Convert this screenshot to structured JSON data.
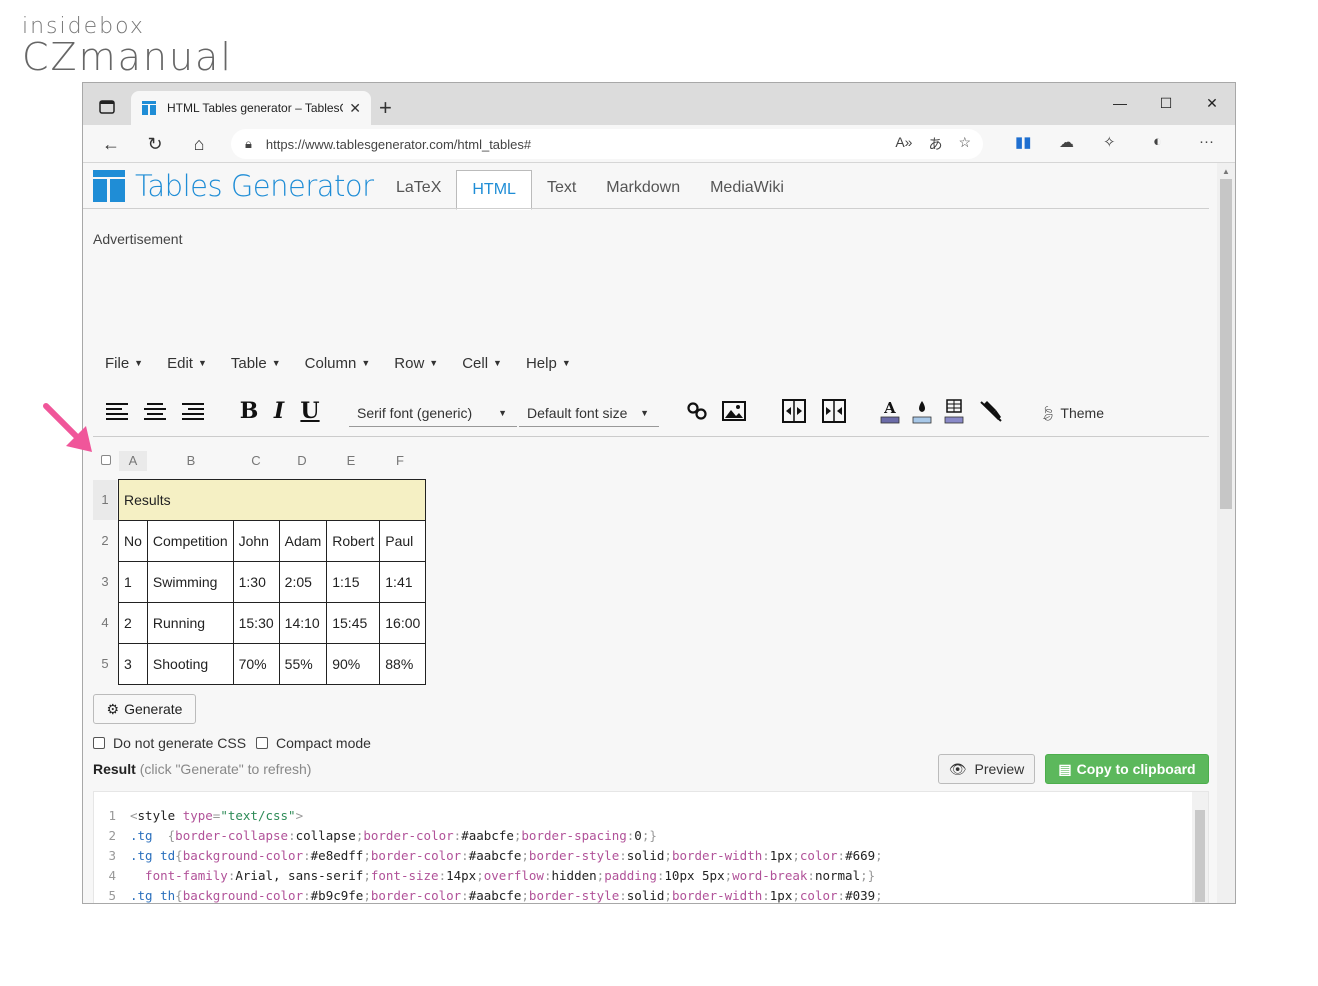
{
  "watermark": {
    "line1": "insidebox",
    "line2": "CZmanual"
  },
  "browser": {
    "tab_title": "HTML Tables generator – TablesG",
    "url": "https://www.tablesgenerator.com/html_tables#",
    "icons": [
      "tab-actions-icon",
      "close-tab-icon",
      "new-tab-icon",
      "back-icon",
      "refresh-icon",
      "home-icon",
      "lock-icon",
      "read-aloud-icon",
      "translate-icon",
      "favorite-add-icon",
      "collections-icon",
      "cloud-icon",
      "extensions-icon",
      "profile-icon",
      "more-icon",
      "minimize-icon",
      "maximize-icon",
      "close-window-icon"
    ]
  },
  "site": {
    "brand": "Tables Generator",
    "tabs": [
      "LaTeX",
      "HTML",
      "Text",
      "Markdown",
      "MediaWiki"
    ],
    "active_tab": "HTML",
    "advertisement": "Advertisement",
    "menus": [
      "File",
      "Edit",
      "Table",
      "Column",
      "Row",
      "Cell",
      "Help"
    ],
    "font_select": "Serif font (generic)",
    "size_select": "Default font size",
    "theme": "Theme",
    "columns": [
      "A",
      "B",
      "C",
      "D",
      "E",
      "F"
    ],
    "row_numbers": [
      "1",
      "2",
      "3",
      "4",
      "5"
    ],
    "table": {
      "title": "Results",
      "header": [
        "No",
        "Competition",
        "John",
        "Adam",
        "Robert",
        "Paul"
      ],
      "rows": [
        [
          "1",
          "Swimming",
          "1:30",
          "2:05",
          "1:15",
          "1:41"
        ],
        [
          "2",
          "Running",
          "15:30",
          "14:10",
          "15:45",
          "16:00"
        ],
        [
          "3",
          "Shooting",
          "70%",
          "55%",
          "90%",
          "88%"
        ]
      ]
    },
    "generate": "Generate",
    "checkbox_css": "Do not generate CSS",
    "checkbox_compact": "Compact mode",
    "result_label": "Result",
    "result_hint": "(click \"Generate\" to refresh)",
    "preview": "Preview",
    "copy": "Copy to clipboard",
    "code_lines": [
      "1",
      "2",
      "3",
      "4",
      "5"
    ]
  },
  "colors": {
    "brand": "#1f8dd6",
    "copy_button": "#5cb85c",
    "highlight_cell": "#f5f0c4",
    "arrow": "#f0569a"
  }
}
